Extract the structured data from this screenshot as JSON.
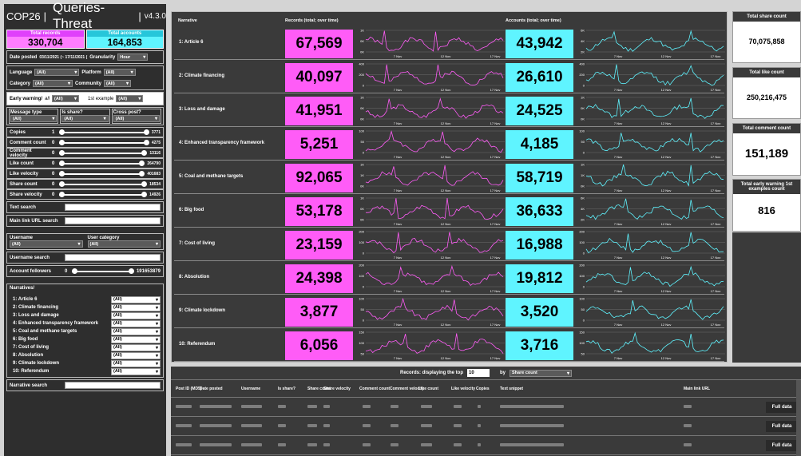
{
  "app": {
    "title_prefix": "COP26",
    "separator": "|",
    "title": "Queries-Threat",
    "version": "v4.3.0"
  },
  "totals": {
    "records_label": "Total records",
    "records_value": "330,704",
    "accounts_label": "Total accounts",
    "accounts_value": "164,853"
  },
  "filters": {
    "date_label": "Date posted",
    "date_value": "03/11/2021 (~ 17/11/2021 (",
    "granularity_label": "Granularity",
    "granularity_value": "Hour",
    "language_label": "Language",
    "language_value": "(All)",
    "platform_label": "Platform",
    "platform_value": "(All)",
    "category_label": "Category",
    "category_value": "(All)",
    "community_label": "Community",
    "community_value": "(All)",
    "early_label": "Early warning/",
    "early_all": "all",
    "early_value": "(All)",
    "first_example_label": "1st example",
    "first_example_value": "(All)",
    "message_type_label": "Message type",
    "message_type_value": "(All)",
    "is_share_label": "Is share?",
    "is_share_value": "(All)",
    "cross_post_label": "Cross post?",
    "cross_post_value": "(All)",
    "sliders": [
      {
        "label": "Copies",
        "min": "1",
        "max": "3771"
      },
      {
        "label": "Comment count",
        "min": "0",
        "max": "4275"
      },
      {
        "label": "Comment velocity",
        "min": "0",
        "max": "13116"
      },
      {
        "label": "Like count",
        "min": "0",
        "max": "264790"
      },
      {
        "label": "Like velocity",
        "min": "0",
        "max": "401683"
      },
      {
        "label": "Share count",
        "min": "0",
        "max": "18534"
      },
      {
        "label": "Share velocity",
        "min": "0",
        "max": "14926"
      }
    ],
    "text_search_label": "Text search",
    "url_search_label": "Main link URL search",
    "username_label": "Username",
    "username_value": "(All)",
    "user_category_label": "User category",
    "user_category_value": "(All)",
    "username_search_label": "Username search",
    "followers_label": "Account followers",
    "followers_min": "0",
    "followers_max": "191653879",
    "narratives_label": "Narratives/",
    "narrative_search_label": "Narrative search"
  },
  "center": {
    "col_narrative": "Narrative",
    "col_records": "Records (total; over time)",
    "col_accounts": "Accounts (total; over time)",
    "x_ticks": [
      "7 Nov",
      "12 Nov",
      "17 Nov"
    ],
    "rows": [
      {
        "label": "1: Article 6",
        "records": "67,569",
        "accounts": "43,942",
        "filter": "(All)",
        "ry": [
          "1K",
          "0K",
          "0K"
        ],
        "ay": [
          "6K",
          "4K",
          "2K"
        ]
      },
      {
        "label": "2: Climate financing",
        "records": "40,097",
        "accounts": "26,610",
        "filter": "(All)",
        "ry": [
          "400",
          "200",
          "0"
        ],
        "ay": [
          "400",
          "200",
          "0"
        ]
      },
      {
        "label": "3: Loss and damage",
        "records": "41,951",
        "accounts": "24,525",
        "filter": "(All)",
        "ry": [
          "1K",
          "0K",
          "0K"
        ],
        "ay": [
          "1K",
          "0K",
          "0K"
        ]
      },
      {
        "label": "4: Enhanced transparency framework",
        "records": "5,251",
        "accounts": "4,185",
        "filter": "(All)",
        "ry": [
          "100",
          "50",
          "0"
        ],
        "ay": [
          "100",
          "50",
          "0"
        ]
      },
      {
        "label": "5: Coal and methane targets",
        "records": "92,065",
        "accounts": "58,719",
        "filter": "(All)",
        "ry": [
          "1K",
          "1K",
          "0K"
        ],
        "ay": [
          "1K",
          "1K",
          "0K"
        ]
      },
      {
        "label": "6: Big food",
        "records": "53,178",
        "accounts": "36,633",
        "filter": "(All)",
        "ry": [
          "1K",
          "0K",
          "0K"
        ],
        "ay": [
          "6K",
          "4K",
          "2K"
        ]
      },
      {
        "label": "7: Cost of living",
        "records": "23,159",
        "accounts": "16,988",
        "filter": "(All)",
        "ry": [
          "200",
          "100",
          "0"
        ],
        "ay": [
          "200",
          "100",
          "0"
        ]
      },
      {
        "label": "8: Absolution",
        "records": "24,398",
        "accounts": "19,812",
        "filter": "(All)",
        "ry": [
          "200",
          "100",
          "0"
        ],
        "ay": [
          "200",
          "100",
          "0"
        ]
      },
      {
        "label": "9: Climate lockdown",
        "records": "3,877",
        "accounts": "3,520",
        "filter": "(All)",
        "ry": [
          "100",
          "50",
          "0"
        ],
        "ay": [
          "100",
          "50",
          "0"
        ]
      },
      {
        "label": "10: Referendum",
        "records": "6,056",
        "accounts": "3,716",
        "filter": "(All)",
        "ry": [
          "150",
          "100",
          "50"
        ],
        "ay": [
          "150",
          "100",
          "50"
        ]
      }
    ]
  },
  "right": {
    "share_label": "Total share count",
    "share_value": "70,075,858",
    "like_label": "Total like count",
    "like_value": "250,216,475",
    "comment_label": "Total comment count",
    "comment_value": "151,189",
    "early_label": "Total early warning 1st examples count",
    "early_value": "816"
  },
  "bottom": {
    "prefix": "Records: displaying the top",
    "top_n": "10",
    "by_label": "by",
    "sort_value": "Share count",
    "headers": [
      "Post ID (MD5)",
      "Date posted",
      "Username",
      "Is share?",
      "Share count",
      "Share velocity",
      "Comment count",
      "Comment velocity",
      "Like count",
      "Like velocity",
      "Copies",
      "Text snippet",
      "Main link URL"
    ],
    "full_data_label": "Full data"
  },
  "colors": {
    "magenta": "#ff5cf7",
    "cyan": "#5ff4ff",
    "panel": "#3a3a3a"
  }
}
